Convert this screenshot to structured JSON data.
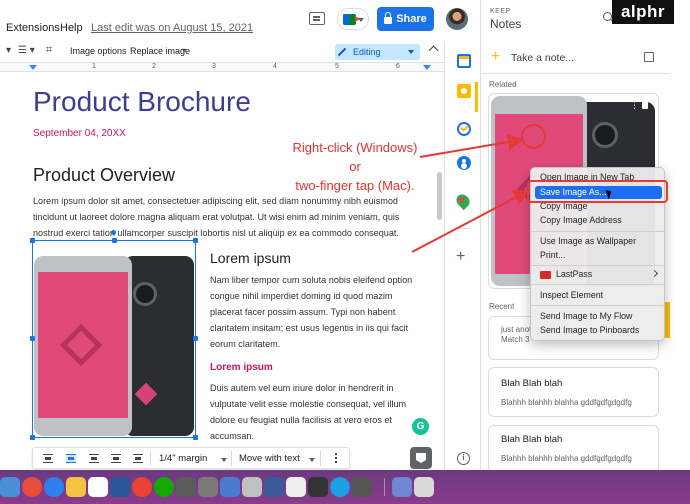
{
  "menubar": {
    "extensions": "Extensions",
    "help": "Help",
    "last_edit": "Last edit was on August 15, 2021",
    "share_label": "Share"
  },
  "toolbar": {
    "image_options": "Image options",
    "replace_image": "Replace image",
    "mode": "Editing"
  },
  "ruler": {
    "numbers": [
      "1",
      "2",
      "3",
      "4",
      "5",
      "6"
    ]
  },
  "document": {
    "title": "Product Brochure",
    "date": "September 04, 20XX",
    "overview_heading": "Product Overview",
    "overview_text": "Lorem ipsum dolor sit amet, consectetuer adipiscing elit, sed diam nonummy nibh euismod tincidunt ut laoreet dolore magna aliquam erat volutpat. Ut wisi enim ad minim veniam, quis nostrud exerci tation ullamcorper suscipit lobortis nisl ut aliquip ex ea commodo consequat.",
    "lorem_heading": "Lorem ipsum",
    "lorem_text_1": "Nam liber tempor cum soluta nobis eleifend option congue nihil imperdiet doming id quod mazim placerat facer possim assum. Typi non habent claritatem insitam; est usus legentis in iis qui facit eorum claritatem.",
    "lorem_subheading": "Lorem ipsum",
    "lorem_text_2": "Duis autem vel eum iriure dolor in hendrerit in vulputate velit esse molestie consequat, vel illum dolore eu feugiat nulla facilisis at vero eros et accumsan."
  },
  "image_toolbar": {
    "margin": "1/4\" margin",
    "wrap_mode": "Move with text"
  },
  "annotation": {
    "line1": "Right-click (Windows)",
    "line2": "or",
    "line3": "two-finger tap (Mac)."
  },
  "keep": {
    "label": "KEEP",
    "title": "Notes",
    "take_note": "Take a note...",
    "related": "Related",
    "recent": "Recent",
    "recent_preview_1": "just another",
    "recent_preview_2": "Match 3",
    "notes": [
      {
        "title": "Blah Blah blah",
        "body": "Blahhh blahhh blahha gddfgdfgdgdfg"
      },
      {
        "title": "Blah Blah blah",
        "body": "Blahhh blahhh blahha gddfgdfgdgdfg"
      }
    ]
  },
  "context_menu": {
    "items": [
      "Open Image in New Tab",
      "Save Image As...",
      "Copy Image",
      "Copy Image Address",
      "Use Image as Wallpaper",
      "Print...",
      "LastPass",
      "Inspect Element",
      "Send Image to My Flow",
      "Send Image to Pinboards"
    ]
  },
  "brand": {
    "logo": "alphr"
  },
  "colors": {
    "accent_blue": "#1a73e8",
    "title_navy": "#3c3e8f",
    "pink": "#c2185b",
    "annotation_red": "#e8322d",
    "keep_yellow": "#fbbc04",
    "menu_highlight": "#1d6ef5"
  },
  "icons": {
    "comment": "comment-icon",
    "meet": "meet-icon",
    "lock": "lock-icon",
    "calendar": "calendar-icon",
    "keep": "keep-icon",
    "tasks": "tasks-icon",
    "contacts": "contacts-icon",
    "maps": "maps-icon",
    "add": "plus-icon",
    "search": "search-icon"
  }
}
